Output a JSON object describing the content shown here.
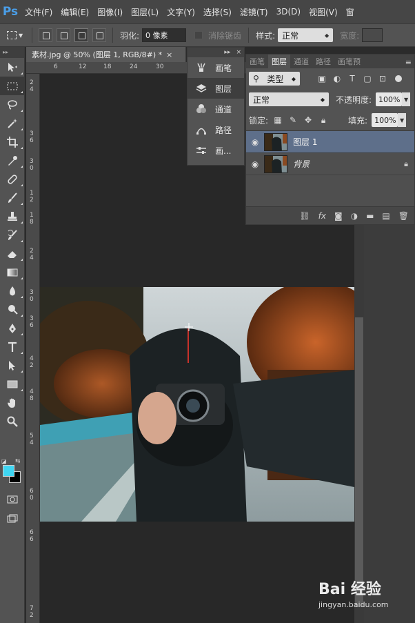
{
  "app": {
    "logo": "Ps"
  },
  "menu": [
    "文件(F)",
    "编辑(E)",
    "图像(I)",
    "图层(L)",
    "文字(Y)",
    "选择(S)",
    "滤镜(T)",
    "3D(D)",
    "视图(V)",
    "窗"
  ],
  "options": {
    "feather_label": "羽化:",
    "feather_value": "0 像素",
    "antialias_label": "消除锯齿",
    "style_label": "样式:",
    "style_value": "正常",
    "width_label": "宽度:"
  },
  "document": {
    "tab_title": "素材.jpg @ 50% (图层 1, RGB/8#) *",
    "ruler_h": [
      "6",
      "12",
      "18",
      "24",
      "30"
    ],
    "ruler_v": [
      "2",
      "4",
      "3",
      "6",
      "3",
      "0",
      "1",
      "2",
      "1",
      "8",
      "2",
      "4",
      "3",
      "0",
      "3",
      "6",
      "4",
      "2",
      "4",
      "8",
      "5",
      "4",
      "6",
      "0",
      "6",
      "6",
      "7",
      "2"
    ]
  },
  "float_panel": {
    "items": [
      "画笔",
      "图层",
      "通道",
      "路径",
      "画..."
    ],
    "active_index": 1
  },
  "layers_panel": {
    "tabs": [
      "画笔",
      "图层",
      "通道",
      "路径",
      "画笔预"
    ],
    "active_tab": 1,
    "filter_label": "类型",
    "blend_mode": "正常",
    "opacity_label": "不透明度:",
    "opacity_value": "100%",
    "lock_label": "锁定:",
    "fill_label": "填充:",
    "fill_value": "100%",
    "layers": [
      {
        "name": "图层 1",
        "selected": true,
        "locked": false
      },
      {
        "name": "背景",
        "selected": false,
        "locked": true
      }
    ]
  },
  "colors": {
    "foreground": "#3fd6f2",
    "background": "#000000",
    "accent": "#4a9ee8"
  },
  "watermark": {
    "logo": "Bai 经验",
    "sub": "jingyan.baidu.com"
  }
}
